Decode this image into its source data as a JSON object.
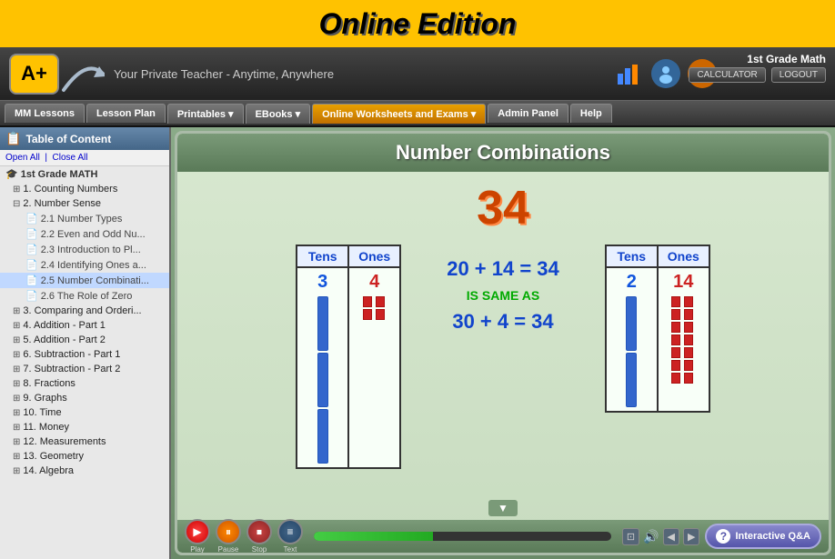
{
  "banner": {
    "title": "Online Edition"
  },
  "header": {
    "logo": "A+",
    "tagline": "Your Private Teacher - Anytime, Anywhere",
    "grade": "1st Grade Math",
    "calculator_label": "CALCULATOR",
    "logout_label": "LOGOUT"
  },
  "nav": {
    "items": [
      {
        "label": "MM Lessons",
        "active": false,
        "highlight": false
      },
      {
        "label": "Lesson Plan",
        "active": false,
        "highlight": false
      },
      {
        "label": "Printables ▾",
        "active": false,
        "highlight": false
      },
      {
        "label": "EBooks ▾",
        "active": false,
        "highlight": false
      },
      {
        "label": "Online Worksheets and Exams ▾",
        "active": false,
        "highlight": true
      },
      {
        "label": "Admin Panel",
        "active": false,
        "highlight": false
      },
      {
        "label": "Help",
        "active": false,
        "highlight": false
      }
    ]
  },
  "sidebar": {
    "title": "Table of Content",
    "open_all": "Open All",
    "close_all": "Close All",
    "separator": "|",
    "tree": [
      {
        "level": 0,
        "label": "1st Grade MATH",
        "type": "root"
      },
      {
        "level": 1,
        "label": "1. Counting Numbers",
        "type": "folder",
        "expanded": false
      },
      {
        "level": 1,
        "label": "2. Number Sense",
        "type": "folder",
        "expanded": true
      },
      {
        "level": 2,
        "label": "2.1 Number Types",
        "type": "leaf"
      },
      {
        "level": 2,
        "label": "2.2 Even and Odd Nu...",
        "type": "leaf"
      },
      {
        "level": 2,
        "label": "2.3 Introduction to Pl...",
        "type": "leaf"
      },
      {
        "level": 2,
        "label": "2.4 Identifying Ones a...",
        "type": "leaf"
      },
      {
        "level": 2,
        "label": "2.5 Number Combinati...",
        "type": "leaf",
        "selected": true
      },
      {
        "level": 2,
        "label": "2.6 The Role of Zero",
        "type": "leaf"
      },
      {
        "level": 1,
        "label": "3. Comparing and Orderi...",
        "type": "folder",
        "expanded": false
      },
      {
        "level": 1,
        "label": "4. Addition - Part 1",
        "type": "folder",
        "expanded": false
      },
      {
        "level": 1,
        "label": "5. Addition - Part 2",
        "type": "folder",
        "expanded": false
      },
      {
        "level": 1,
        "label": "6. Subtraction - Part 1",
        "type": "folder",
        "expanded": false
      },
      {
        "level": 1,
        "label": "7. Subtraction - Part 2",
        "type": "folder",
        "expanded": false
      },
      {
        "level": 1,
        "label": "8. Fractions",
        "type": "folder",
        "expanded": false
      },
      {
        "level": 1,
        "label": "9. Graphs",
        "type": "folder",
        "expanded": false
      },
      {
        "level": 1,
        "label": "10. Time",
        "type": "folder",
        "expanded": false
      },
      {
        "level": 1,
        "label": "11. Money",
        "type": "folder",
        "expanded": false
      },
      {
        "level": 1,
        "label": "12. Measurements",
        "type": "folder",
        "expanded": false
      },
      {
        "level": 1,
        "label": "13. Geometry",
        "type": "folder",
        "expanded": false
      },
      {
        "level": 1,
        "label": "14. Algebra",
        "type": "folder",
        "expanded": false
      }
    ]
  },
  "lesson": {
    "title": "Number Combinations",
    "big_number": "34",
    "left_table": {
      "tens_header": "Tens",
      "ones_header": "Ones",
      "tens_value": "3",
      "ones_value": "4"
    },
    "right_table": {
      "tens_header": "Tens",
      "ones_header": "Ones",
      "tens_value": "2",
      "ones_value": "14"
    },
    "equation1": "20 + 14 = 34",
    "is_same_as": "IS SAME AS",
    "equation2": "30 + 4 = 34"
  },
  "controls": {
    "play_label": "Play",
    "pause_label": "Pause",
    "stop_label": "Stop",
    "text_label": "Text",
    "qa_label": "Interactive Q&A"
  }
}
